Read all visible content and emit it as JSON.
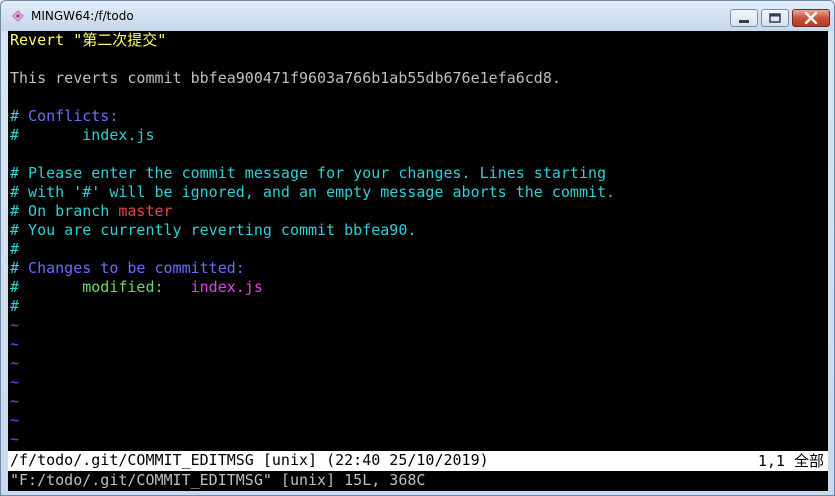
{
  "window": {
    "title": "MINGW64:/f/todo"
  },
  "editor": {
    "lines": {
      "l1": "Revert \"第二次提交\"",
      "l3": "This reverts commit bbfea900471f9603a766b1ab55db676e1efa6cd8.",
      "l5_hash": "#",
      "l5_text": " Conflicts:",
      "l6_hash": "#",
      "l6_text": "       index.js",
      "l8": "# Please enter the commit message for your changes. Lines starting",
      "l9": "# with '#' will be ignored, and an empty message aborts the commit.",
      "l10_prefix": "# On branch ",
      "l10_branch": "master",
      "l11": "# You are currently reverting commit bbfea90.",
      "l12": "#",
      "l13_hash": "#",
      "l13_text": " Changes to be committed:",
      "l14_hash": "#",
      "l14_modified": "       modified:",
      "l14_file": "   index.js",
      "l15": "#"
    },
    "tilde": "~"
  },
  "statusbar": {
    "file_info": "/f/todo/.git/COMMIT_EDITMSG [unix] (22:40 25/10/2019)",
    "position": "1,1 全部"
  },
  "message": "\"F:/todo/.git/COMMIT_EDITMSG\" [unix] 15L, 368C",
  "colors": {
    "background": "#000000",
    "text": "#bfbfbf",
    "title_yellow": "#ffff66",
    "comment_cyan": "#2fd0d6",
    "header_blue": "#6b6bff",
    "branch_red": "#e84646",
    "modified_green": "#5ee05e",
    "file_magenta": "#e040e0",
    "tilde_blue": "#4060ff"
  },
  "icons": [
    "app-icon",
    "minimize-icon",
    "maximize-icon",
    "close-icon"
  ]
}
